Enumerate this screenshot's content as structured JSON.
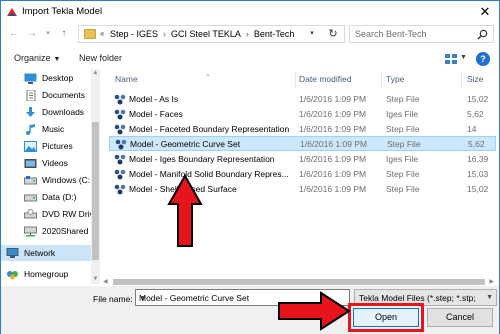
{
  "window": {
    "title": "Import Tekla Model"
  },
  "address": {
    "crumbs": [
      "Step - IGES",
      "GCI Steel  TEKLA",
      "Bent-Tech"
    ],
    "overflow": "«"
  },
  "search": {
    "placeholder": "Search Bent-Tech"
  },
  "toolbar": {
    "organize": "Organize",
    "new_folder": "New folder"
  },
  "nav": {
    "items": [
      {
        "label": "Desktop",
        "icon": "desktop-icon"
      },
      {
        "label": "Documents",
        "icon": "documents-icon"
      },
      {
        "label": "Downloads",
        "icon": "downloads-icon"
      },
      {
        "label": "Music",
        "icon": "music-icon"
      },
      {
        "label": "Pictures",
        "icon": "pictures-icon"
      },
      {
        "label": "Videos",
        "icon": "videos-icon"
      },
      {
        "label": "Windows (C:",
        "icon": "drive-icon"
      },
      {
        "label": "Data (D:)",
        "icon": "drive-icon"
      },
      {
        "label": "DVD RW Driv",
        "icon": "dvd-icon"
      },
      {
        "label": "2020Shared (",
        "icon": "network-drive-icon"
      },
      {
        "label": "Network",
        "icon": "network-icon"
      },
      {
        "label": "Homegroup",
        "icon": "homegroup-icon"
      }
    ]
  },
  "columns": {
    "name": "Name",
    "date": "Date modified",
    "type": "Type",
    "size": "Size"
  },
  "files": [
    {
      "name": "Model - As Is",
      "date": "1/6/2016 1:09 PM",
      "type": "Step File",
      "size": "15,02"
    },
    {
      "name": "Model - Faces",
      "date": "1/6/2016 1:09 PM",
      "type": "Iges File",
      "size": "5,62"
    },
    {
      "name": "Model - Faceted Boundary Representation",
      "date": "1/6/2016 1:09 PM",
      "type": "Step File",
      "size": "14"
    },
    {
      "name": "Model - Geometric Curve Set",
      "date": "1/6/2016 1:09 PM",
      "type": "Step File",
      "size": "5,62"
    },
    {
      "name": "Model - Iges Boundary Representation",
      "date": "1/6/2016 1:09 PM",
      "type": "Iges File",
      "size": "16,39"
    },
    {
      "name": "Model - Manifold Solid Boundary Repres...",
      "date": "1/6/2016 1:09 PM",
      "type": "Step File",
      "size": "15,03"
    },
    {
      "name": "Model - Shell Based Surface",
      "date": "1/6/2016 1:09 PM",
      "type": "Step File",
      "size": "15,02"
    }
  ],
  "selected_index": 3,
  "bottom": {
    "file_name_label": "File name:",
    "file_name_value": "Model - Geometric Curve Set",
    "filter_value": "Tekla Model Files (*.step; *.stp;",
    "open": "Open",
    "cancel": "Cancel"
  },
  "colors": {
    "annotation": "#e8141b",
    "selection": "#cce8ff",
    "accent": "#0078d7"
  }
}
